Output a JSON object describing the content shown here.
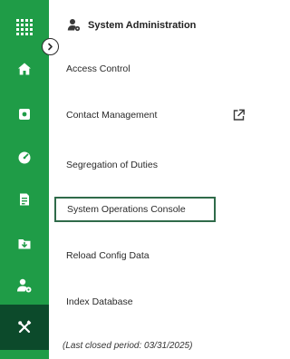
{
  "rail": {
    "items": [
      {
        "icon": "apps-grid-icon",
        "active": false
      },
      {
        "icon": "home-icon",
        "active": false
      },
      {
        "icon": "document-icon",
        "active": false
      },
      {
        "icon": "dashboard-gauge-icon",
        "active": false
      },
      {
        "icon": "report-icon",
        "active": false
      },
      {
        "icon": "folder-download-icon",
        "active": false
      },
      {
        "icon": "user-settings-icon",
        "active": false
      },
      {
        "icon": "tools-icon",
        "active": true
      }
    ],
    "colors": {
      "background": "#1f9c47",
      "active": "#0c4a2b"
    }
  },
  "collapse_toggle": {
    "icon": "chevron-right-icon"
  },
  "panel": {
    "title": "System Administration",
    "title_icon": "user-admin-icon",
    "items": [
      {
        "label": "Access Control"
      },
      {
        "label": "Contact Management",
        "external_icon": "external-link-icon"
      },
      {
        "label": "Segregation of Duties"
      },
      {
        "label": "System Operations Console",
        "selected": true
      },
      {
        "label": "Reload Config Data"
      },
      {
        "label": "Index Database"
      }
    ],
    "footer": "(Last closed period: 03/31/2025)",
    "colors": {
      "selected_border": "#2f6b4a"
    }
  }
}
